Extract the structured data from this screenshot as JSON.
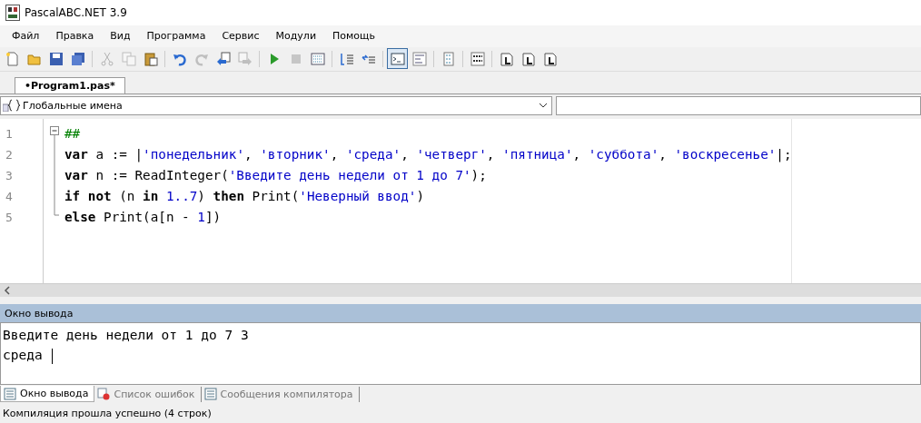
{
  "window": {
    "title": "PascalABC.NET 3.9"
  },
  "menu": [
    "Файл",
    "Правка",
    "Вид",
    "Программа",
    "Сервис",
    "Модули",
    "Помощь"
  ],
  "toolbar": [
    {
      "kind": "new",
      "disabled": false,
      "on": false
    },
    {
      "kind": "open",
      "disabled": false,
      "on": false
    },
    {
      "kind": "save",
      "disabled": false,
      "on": false
    },
    {
      "kind": "saveall",
      "disabled": false,
      "on": false
    },
    {
      "kind": "sep"
    },
    {
      "kind": "cut",
      "disabled": true,
      "on": false
    },
    {
      "kind": "copy",
      "disabled": true,
      "on": false
    },
    {
      "kind": "paste",
      "disabled": false,
      "on": false
    },
    {
      "kind": "sep"
    },
    {
      "kind": "undo",
      "disabled": false,
      "on": false
    },
    {
      "kind": "redo",
      "disabled": true,
      "on": false
    },
    {
      "kind": "back",
      "disabled": false,
      "on": false
    },
    {
      "kind": "fwd",
      "disabled": true,
      "on": false
    },
    {
      "kind": "sep"
    },
    {
      "kind": "run",
      "disabled": false,
      "on": false
    },
    {
      "kind": "stop",
      "disabled": true,
      "on": false
    },
    {
      "kind": "build",
      "disabled": false,
      "on": false
    },
    {
      "kind": "sep"
    },
    {
      "kind": "indent",
      "disabled": false,
      "on": false
    },
    {
      "kind": "outdent",
      "disabled": false,
      "on": false
    },
    {
      "kind": "sep"
    },
    {
      "kind": "console",
      "disabled": false,
      "on": true
    },
    {
      "kind": "abc",
      "disabled": false,
      "on": false
    },
    {
      "kind": "sep"
    },
    {
      "kind": "list",
      "disabled": false,
      "on": false
    },
    {
      "kind": "sep"
    },
    {
      "kind": "code",
      "disabled": false,
      "on": false
    },
    {
      "kind": "sep"
    },
    {
      "kind": "doc",
      "disabled": false,
      "on": false
    },
    {
      "kind": "doc",
      "disabled": false,
      "on": false
    },
    {
      "kind": "doc",
      "disabled": false,
      "on": false
    }
  ],
  "tabs": [
    {
      "label": "•Program1.pas*",
      "selected": true
    }
  ],
  "scope_dropdown": {
    "value": "Глобальные имена"
  },
  "editor": {
    "lines": [
      {
        "number": "1",
        "tokens": [
          {
            "kind": "comment",
            "text": "##"
          }
        ]
      },
      {
        "number": "2",
        "tokens": [
          {
            "kind": "keyword",
            "text": "var"
          },
          {
            "kind": "plain",
            "text": " a := |"
          },
          {
            "kind": "string",
            "text": "'понедельник'"
          },
          {
            "kind": "plain",
            "text": ", "
          },
          {
            "kind": "string",
            "text": "'вторник'"
          },
          {
            "kind": "plain",
            "text": ", "
          },
          {
            "kind": "string",
            "text": "'среда'"
          },
          {
            "kind": "plain",
            "text": ", "
          },
          {
            "kind": "string",
            "text": "'четверг'"
          },
          {
            "kind": "plain",
            "text": ", "
          },
          {
            "kind": "string",
            "text": "'пятница'"
          },
          {
            "kind": "plain",
            "text": ", "
          },
          {
            "kind": "string",
            "text": "'суббота'"
          },
          {
            "kind": "plain",
            "text": ", "
          },
          {
            "kind": "string",
            "text": "'воскресенье'"
          },
          {
            "kind": "plain",
            "text": "|;"
          }
        ]
      },
      {
        "number": "3",
        "tokens": [
          {
            "kind": "keyword",
            "text": "var"
          },
          {
            "kind": "plain",
            "text": " n := ReadInteger("
          },
          {
            "kind": "string",
            "text": "'Введите день недели от 1 до 7'"
          },
          {
            "kind": "plain",
            "text": ");"
          }
        ]
      },
      {
        "number": "4",
        "tokens": [
          {
            "kind": "keyword",
            "text": "if not"
          },
          {
            "kind": "plain",
            "text": " (n "
          },
          {
            "kind": "keyword",
            "text": "in"
          },
          {
            "kind": "number",
            "text": " 1..7"
          },
          {
            "kind": "plain",
            "text": ") "
          },
          {
            "kind": "keyword",
            "text": "then"
          },
          {
            "kind": "plain",
            "text": " Print("
          },
          {
            "kind": "string",
            "text": "'Неверный ввод'"
          },
          {
            "kind": "plain",
            "text": ")"
          }
        ]
      },
      {
        "number": "5",
        "tokens": [
          {
            "kind": "keyword",
            "text": "else"
          },
          {
            "kind": "plain",
            "text": " Print(a[n - "
          },
          {
            "kind": "number",
            "text": "1"
          },
          {
            "kind": "plain",
            "text": "])"
          }
        ]
      }
    ]
  },
  "output": {
    "title": "Окно вывода",
    "lines": [
      "Введите день недели от 1 до 7 3",
      "среда"
    ]
  },
  "bottom_tabs": [
    {
      "label": "Окно вывода",
      "kind": "output",
      "selected": true
    },
    {
      "label": "Список ошибок",
      "kind": "errors",
      "selected": false
    },
    {
      "label": "Сообщения компилятора",
      "kind": "messages",
      "selected": false
    }
  ],
  "status_bar": "Компиляция прошла успешно (4 строк)"
}
